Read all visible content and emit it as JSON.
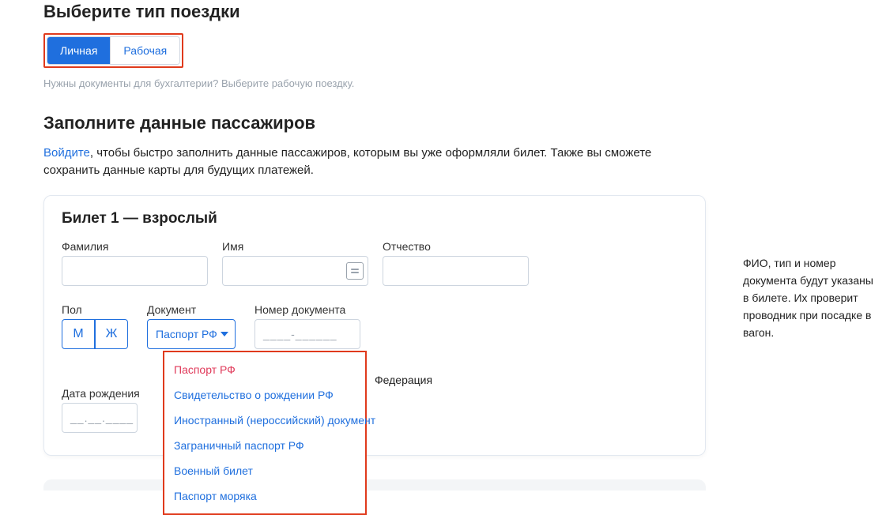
{
  "tripType": {
    "heading": "Выберите тип поездки",
    "options": {
      "personal": "Личная",
      "work": "Рабочая"
    },
    "hint": "Нужны документы для бухгалтерии? Выберите рабочую поездку."
  },
  "passengers": {
    "heading": "Заполните данные пассажиров",
    "loginLink": "Войдите",
    "loginTail": ", чтобы быстро заполнить данные пассажиров, которым вы уже оформляли билет. Также вы сможете сохранить данные карты для будущих платежей."
  },
  "ticket": {
    "title": "Билет 1 — взрослый",
    "labels": {
      "lastname": "Фамилия",
      "firstname": "Имя",
      "patronymic": "Отчество",
      "gender": "Пол",
      "document": "Документ",
      "docnum": "Номер документа",
      "dob": "Дата рождения"
    },
    "gender": {
      "m": "М",
      "f": "Ж"
    },
    "docSelected": "Паспорт РФ",
    "docnumMask": "____-______",
    "citizenship": "Федерация",
    "dobMask": "__.__.____",
    "docOptions": [
      "Паспорт РФ",
      "Свидетельство о рождении РФ",
      "Иностранный (нероссийский) документ",
      "Заграничный паспорт РФ",
      "Военный билет",
      "Паспорт моряка"
    ]
  },
  "sideNote": "ФИО, тип и номер документа будут указаны в билете. Их проверит проводник при посадке в вагон."
}
